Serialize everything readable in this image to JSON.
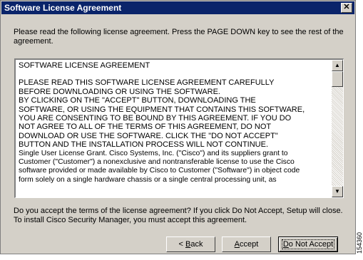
{
  "window": {
    "title": "Software License Agreement",
    "close_label": "✕"
  },
  "intro_text": "Please read the following license agreement.  Press the PAGE DOWN key to see the rest of the agreement.",
  "license": {
    "heading": "SOFTWARE LICENSE AGREEMENT",
    "body": "PLEASE READ THIS SOFTWARE LICENSE AGREEMENT CAREFULLY\nBEFORE DOWNLOADING OR USING THE SOFTWARE.\nBY CLICKING ON THE \"ACCEPT\" BUTTON, DOWNLOADING THE\nSOFTWARE, OR USING THE EQUIPMENT THAT CONTAINS THIS SOFTWARE,\nYOU ARE CONSENTING TO BE BOUND BY THIS AGREEMENT. IF YOU DO\nNOT AGREE TO ALL OF THE TERMS OF THIS AGREEMENT, DO NOT\nDOWNLOAD OR USE THE SOFTWARE. CLICK THE \"DO NOT ACCEPT\"\nBUTTON AND THE INSTALLATION PROCESS WILL NOT CONTINUE.",
    "grant": "Single User License Grant. Cisco Systems, Inc. (\"Cisco\") and its suppliers grant to\nCustomer (\"Customer\") a nonexclusive and nontransferable license to use the Cisco\nsoftware provided or made available by Cisco to Customer (\"Software\") in object code\nform solely on a single hardware chassis or a single central processing unit, as"
  },
  "question_text": "Do you accept the terms of the license agreement? If you click Do Not Accept, Setup will close.  To install Cisco Security Manager, you must accept this agreement.",
  "buttons": {
    "back_prefix": "< ",
    "back_hotkey": "B",
    "back_rest": "ack",
    "accept_hotkey": "A",
    "accept_rest": "ccept",
    "do_not_accept_hotkey": "D",
    "do_not_accept_rest": "o Not Accept"
  },
  "figure_id": "154360"
}
